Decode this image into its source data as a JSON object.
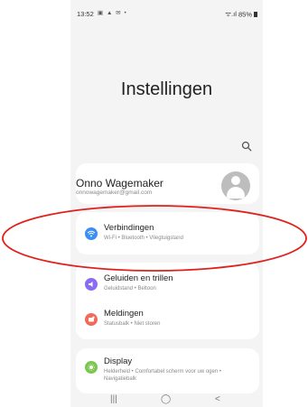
{
  "status_bar": {
    "time": "13:52",
    "notification_icons": "▣ ▲ ✉ •",
    "signal": "ᯤ.ıl",
    "battery": "85%"
  },
  "header": {
    "title": "Instellingen"
  },
  "search": {
    "icon": "search-icon"
  },
  "profile": {
    "name": "Onno Wagemaker",
    "email": "onnowagemaker@gmail.com"
  },
  "settings": [
    {
      "title": "Verbindingen",
      "subtitle": "Wi-Fi  •  Bluetooth  •  Vliegtuigstand",
      "icon": "wifi-icon",
      "color": "#3d8ef2"
    },
    {
      "title": "Geluiden en trillen",
      "subtitle": "Geluidstand  •  Beltoon",
      "icon": "volume-icon",
      "color": "#8b6cf0"
    },
    {
      "title": "Meldingen",
      "subtitle": "Statusbalk  •  Niet storen",
      "icon": "notification-icon",
      "color": "#f06b5a"
    },
    {
      "title": "Display",
      "subtitle": "Helderheid  •  Comfortabel scherm voor uw ogen  •  Navigatiebalk",
      "icon": "brightness-icon",
      "color": "#7bc74d"
    }
  ],
  "nav": {
    "recents": "|||",
    "home": "◯",
    "back": "<"
  },
  "annotation": {
    "color": "#e0201b"
  }
}
